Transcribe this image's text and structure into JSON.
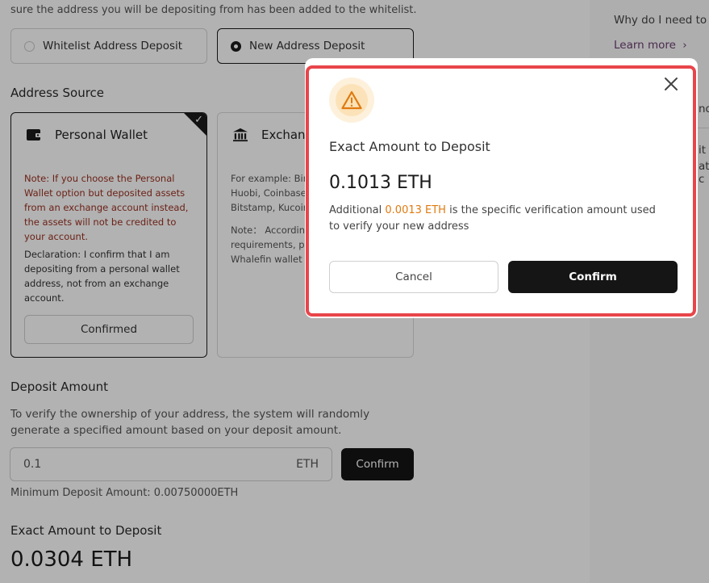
{
  "top_note": "sure the address you will be depositing from has been added to the whitelist.",
  "deposit_type": {
    "options": [
      {
        "label": "Whitelist Address Deposit",
        "selected": false
      },
      {
        "label": "New Address Deposit",
        "selected": true
      }
    ]
  },
  "address_source": {
    "label": "Address Source",
    "personal": {
      "title": "Personal Wallet",
      "note": "Note: If you choose the Personal Wallet option but deposited assets from an exchange account instead, the assets will not be credited to your account.",
      "declaration": "Declaration: I confirm that I am depositing from a personal wallet address, not from an exchange account.",
      "button": "Confirmed"
    },
    "exchange": {
      "title": "Exchang",
      "example_l1": "For example: Bina",
      "example_l2": "Huobi, Coinbase,",
      "example_l3": "Bitstamp, Kucoin",
      "note_l1": "Note： According",
      "note_l2": "requirements, ple",
      "note_l3": "Whalefin wallet fo"
    }
  },
  "deposit_amount": {
    "label": "Deposit Amount",
    "description": "To verify the ownership of your address, the system will randomly generate a specified amount based on your deposit amount.",
    "value": "0.1",
    "unit": "ETH",
    "confirm": "Confirm",
    "minimum": "Minimum Deposit Amount: 0.00750000ETH"
  },
  "exact_amount": {
    "label": "Exact Amount to Deposit",
    "value": "0.0304 ETH"
  },
  "right_panel": {
    "question": "Why do I need to d",
    "link": "Learn more",
    "frag1": "no",
    "frag2": "it",
    "frag3": "at c"
  },
  "modal": {
    "title": "Exact Amount to Deposit",
    "amount": "0.1013 ETH",
    "text_before": "Additional ",
    "highlight": "0.0013 ETH",
    "text_after": " is the specific verification amount used to verify your new address",
    "cancel": "Cancel",
    "confirm": "Confirm"
  },
  "colors": {
    "accent_dark": "#151515",
    "highlight_orange": "#e07a10",
    "outline_red": "#e8454a",
    "note_red": "#9a3020",
    "link_purple": "#6b3e70"
  }
}
